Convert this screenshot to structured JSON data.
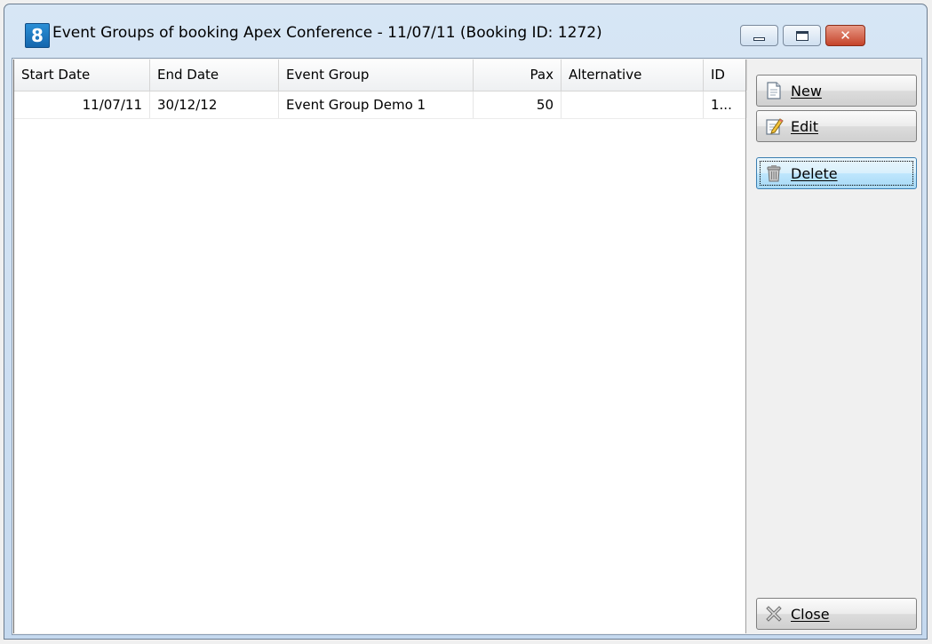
{
  "window": {
    "app_icon_glyph": "8",
    "title": "Event Groups of booking Apex Conference - 11/07/11 (Booking ID: 1272)",
    "controls": {
      "minimize": "minimize-icon",
      "maximize": "maximize-icon",
      "close": "close-icon",
      "close_glyph": "✕"
    },
    "colors": {
      "frame": "#c5d9ef",
      "close_button": "#c5432a"
    }
  },
  "table": {
    "columns": [
      "Start Date",
      "End Date",
      "Event Group",
      "Pax",
      "Alternative",
      "ID"
    ],
    "rows": [
      {
        "start_date": "11/07/11",
        "end_date": "30/12/12",
        "event_group": "Event Group Demo 1",
        "pax": "50",
        "alternative": "",
        "id": "1..."
      }
    ]
  },
  "buttons": {
    "new": {
      "label": "New",
      "icon": "new-document-icon"
    },
    "edit": {
      "label": "Edit",
      "icon": "edit-pencil-icon"
    },
    "delete": {
      "label": "Delete",
      "icon": "trash-icon"
    },
    "close": {
      "label": "Close",
      "icon": "close-x-icon"
    }
  }
}
